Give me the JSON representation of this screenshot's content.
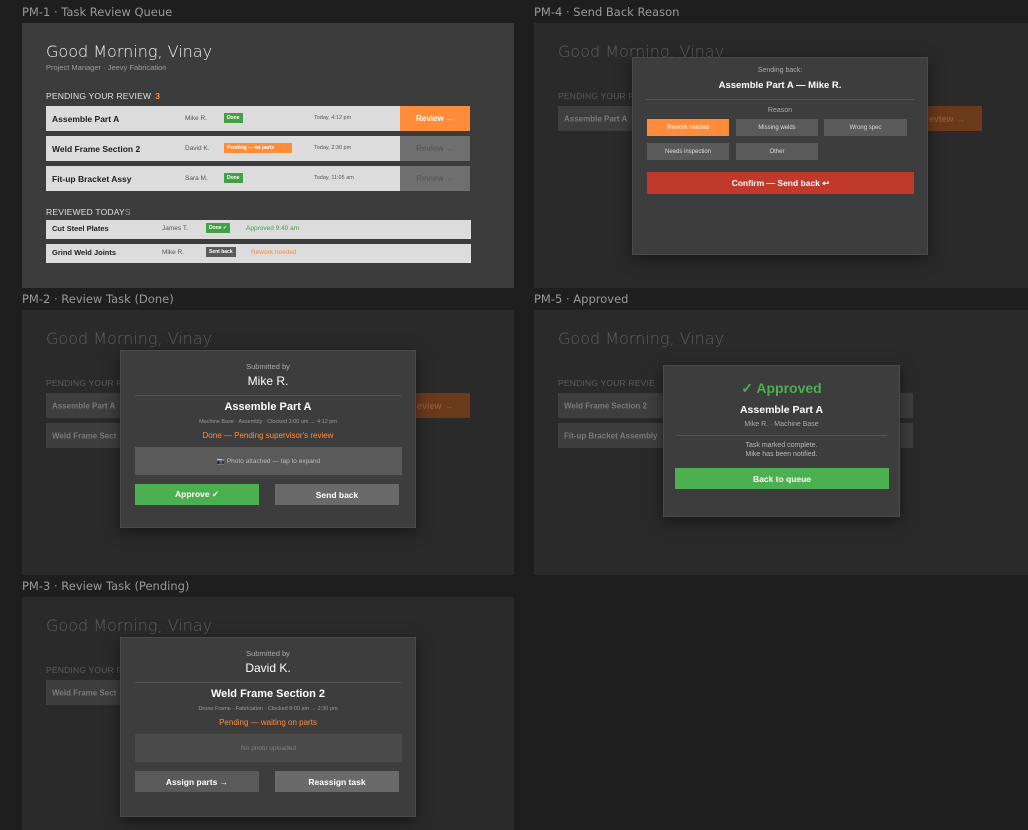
{
  "frames": {
    "pm1": "PM-1 · Task Review Queue",
    "pm2": "PM-2 · Review Task (Done)",
    "pm3": "PM-3 · Review Task (Pending)",
    "pm4": "PM-4 · Send Back Reason",
    "pm5": "PM-5 · Approved"
  },
  "common": {
    "greeting": "Good Morning, Vinay",
    "subtitle": "Project Manager · Jeevy Fabrication",
    "pending_heading": "PENDING YOUR REVIEW",
    "pending_heading_cut": "PENDING YOUR REVIE",
    "pending_count": "3",
    "reviewed_heading": "REVIEWED TODAY",
    "reviewed_count": "S",
    "review_button": "Review →",
    "review_button_cut": "eview →"
  },
  "pending": [
    {
      "title": "Assemble Part A",
      "who": "Mike R.",
      "badge": "Done",
      "badge_color": "#43a047",
      "time": "Today, 4:12 pm",
      "active": true
    },
    {
      "title": "Weld Frame Section 2",
      "who": "David K.",
      "badge": "Pending — no parts",
      "badge_color": "#ff8c3a",
      "time": "Today, 2:30 pm",
      "active": false
    },
    {
      "title": "Fit-up Bracket Assy",
      "who": "Sara M.",
      "badge": "Done",
      "badge_color": "#43a047",
      "time": "Today, 11:05 am",
      "active": false
    }
  ],
  "reviewed": [
    {
      "title": "Cut Steel Plates",
      "who": "James T.",
      "badge": "Done ✓",
      "badge_color": "#43a047",
      "status": "Approved 9:40 am",
      "status_color": "#43a047"
    },
    {
      "title": "Grind Weld Joints",
      "who": "Mike R.",
      "badge": "Sent back",
      "badge_color": "#5a5a5a",
      "status": "Rework needed",
      "status_color": "#ff8c3a"
    }
  ],
  "pm2": {
    "bg_rows": [
      "Assemble Part A",
      "Weld Frame Sect"
    ],
    "submitted_by_label": "Submitted by",
    "submitter": "Mike R.",
    "task": "Assemble Part A",
    "meta": "Machine Base · Assembly · Clocked 3:00 am → 4:12 pm",
    "state": "Done — Pending supervisor's review",
    "photo": "📷 Photo attached — tap to expand",
    "approve": "Approve ✓",
    "send_back": "Send back"
  },
  "pm3": {
    "bg_rows": [
      "Weld Frame Sect"
    ],
    "submitted_by_label": "Submitted by",
    "submitter": "David K.",
    "task": "Weld Frame Section 2",
    "meta": "Drone Frame · Fabrication · Clocked 8:00 am → 2:30 pm",
    "state": "Pending — waiting on parts",
    "photo": "No photo uploaded",
    "assign": "Assign parts →",
    "reassign": "Reassign task"
  },
  "pm4": {
    "bg_rows": [
      "Assemble Part A"
    ],
    "sending_back_label": "Sending back:",
    "target": "Assemble Part A — Mike R.",
    "reason_label": "Reason",
    "reasons": [
      "Rework needed",
      "Missing welds",
      "Wrong spec",
      "Needs inspection",
      "Other"
    ],
    "selected_reason": "Rework needed",
    "confirm": "Confirm — Send back ↩"
  },
  "pm5": {
    "bg_rows": [
      "Weld Frame Section 2",
      "Fit-up Bracket Assembly"
    ],
    "approved": "✓ Approved",
    "task": "Assemble Part A",
    "meta": "Mike R. · Machine Base",
    "msg1": "Task marked complete.",
    "msg2": "Mike has been notified.",
    "back": "Back to queue"
  }
}
